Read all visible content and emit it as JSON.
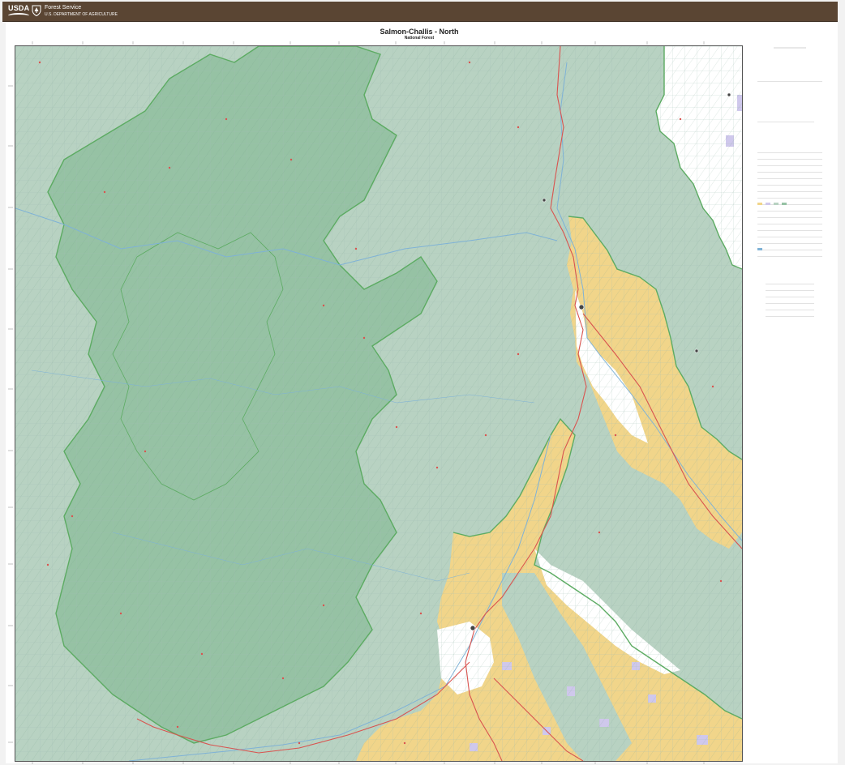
{
  "banner": {
    "logo_text": "USDA",
    "agency": "Forest Service",
    "department": "U.S. DEPARTMENT OF AGRICULTURE",
    "color": "#5a4533"
  },
  "map": {
    "title": "Salmon-Challis - North",
    "subtitle": "National Forest",
    "colors": {
      "wilderness": "#96c2a4",
      "forest": "#b8d2c2",
      "blm": "#f1d58a",
      "private": "#ffffff",
      "state": "#cfc8ec",
      "boundary": "#5cab62",
      "road": "#d9534f",
      "water": "#7fb2d6"
    }
  }
}
